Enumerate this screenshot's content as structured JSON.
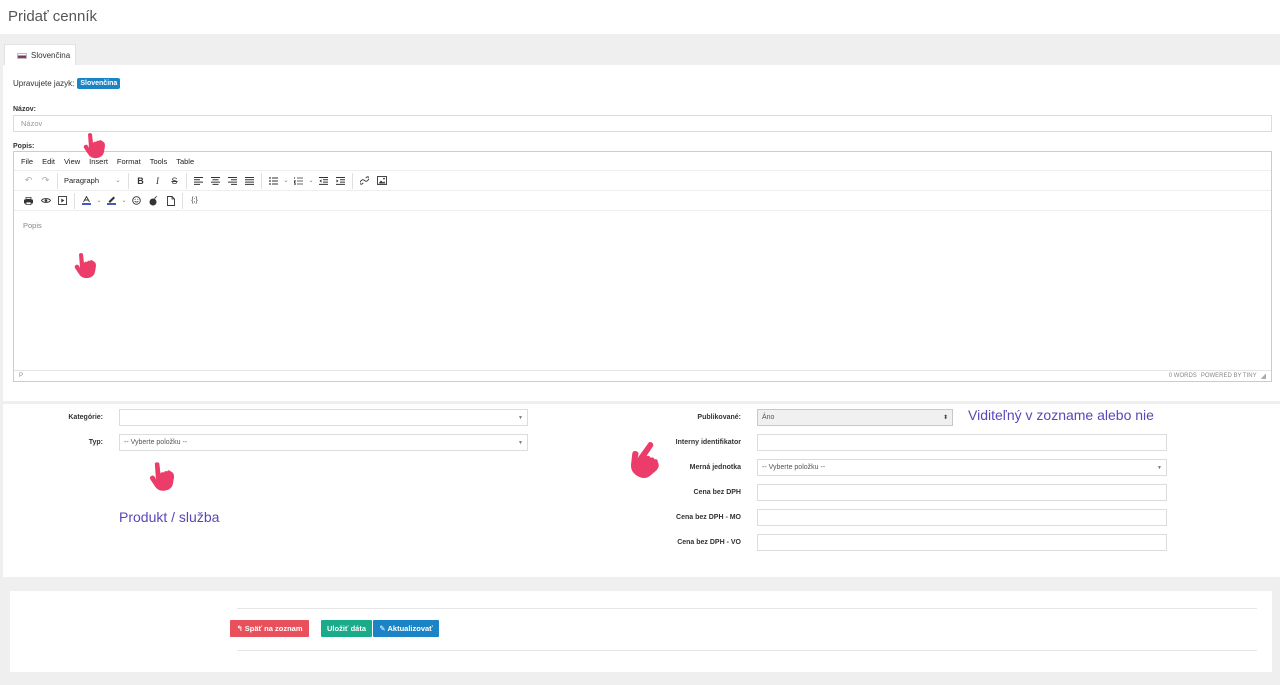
{
  "page": {
    "title": "Pridať cenník"
  },
  "tabs": [
    {
      "label": "Slovenčina"
    }
  ],
  "language": {
    "prefix": "Upravujete jazyk:",
    "badge": "Slovenčina"
  },
  "name_field": {
    "label": "Názov:",
    "placeholder": "Názov"
  },
  "description": {
    "label": "Popis:",
    "menu": [
      "File",
      "Edit",
      "View",
      "Insert",
      "Format",
      "Tools",
      "Table"
    ],
    "block_format": "Paragraph",
    "placeholder": "Popis",
    "status_path": "P",
    "word_count": "0 WORDS",
    "powered": "POWERED BY TINY"
  },
  "form": {
    "category_label": "Kategórie:",
    "type_label": "Typ:",
    "type_value": "-- Vyberte položku --",
    "published_label": "Publikované:",
    "published_value": "Áno",
    "internal_id_label": "Interny identifikator",
    "unit_label": "Merná jednotka",
    "unit_value": "-- Vyberte položku --",
    "price_label": "Cena bez DPH",
    "price_mo_label": "Cena bez DPH - MO",
    "price_vo_label": "Cena bez DPH - VO"
  },
  "annotations": {
    "visible_note": "Viditeľný v zozname alebo nie",
    "type_note": "Produkt / služba"
  },
  "buttons": {
    "back": "Späť na zoznam",
    "save": "Uložiť dáta",
    "update": "Aktualizovať"
  },
  "colors": {
    "badge": "#1b84c6",
    "back": "#e8505b",
    "save": "#1aab8b",
    "update": "#1b84c6",
    "annotation": "#5748b8",
    "pointer": "#ec3d6a"
  }
}
